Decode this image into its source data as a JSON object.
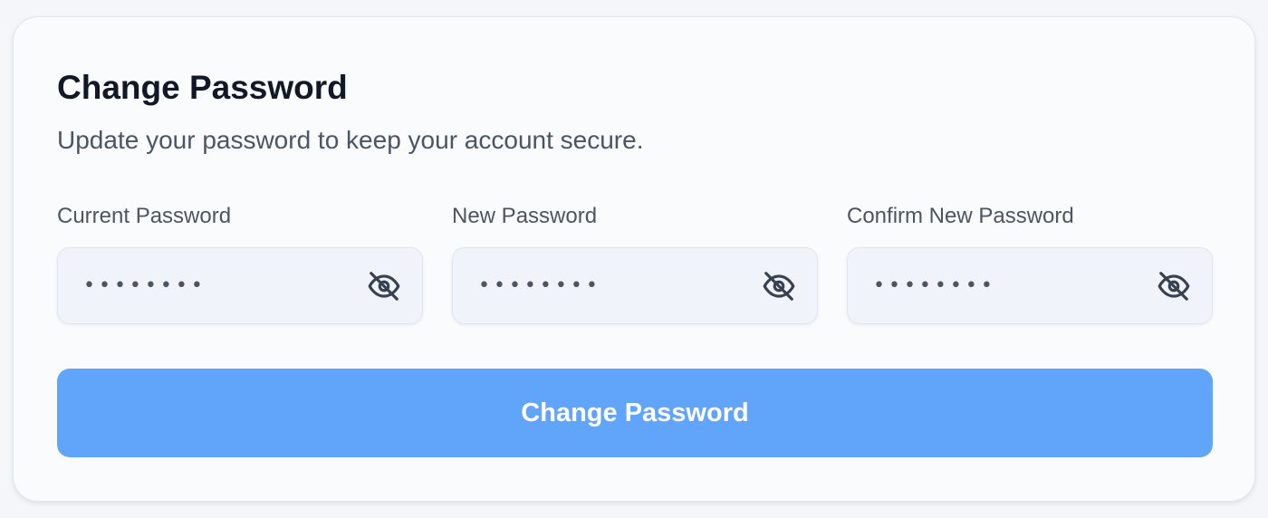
{
  "form": {
    "title": "Change Password",
    "subtitle": "Update your password to keep your account secure.",
    "fields": [
      {
        "label": "Current Password",
        "masked_value": "••••••••",
        "visibility_icon": "eye-off-icon"
      },
      {
        "label": "New Password",
        "masked_value": "••••••••",
        "visibility_icon": "eye-off-icon"
      },
      {
        "label": "Confirm New Password",
        "masked_value": "••••••••",
        "visibility_icon": "eye-off-icon"
      }
    ],
    "submit_label": "Change Password"
  },
  "colors": {
    "page_background": "#f4f6fa",
    "card_background": "#fafbfd",
    "input_background": "#f0f3fa",
    "button_accent": "#60a5fa",
    "title_text": "#111827",
    "muted_text": "#4b5563"
  }
}
